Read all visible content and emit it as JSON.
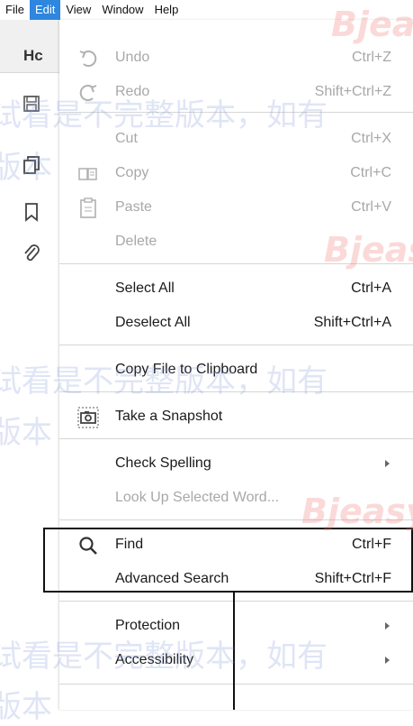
{
  "menubar": {
    "items": [
      {
        "label": "File",
        "active": false
      },
      {
        "label": "Edit",
        "active": true
      },
      {
        "label": "View",
        "active": false
      },
      {
        "label": "Window",
        "active": false
      },
      {
        "label": "Help",
        "active": false
      }
    ]
  },
  "app": {
    "tab_label": "Hc"
  },
  "menu": {
    "undo": {
      "label": "Undo",
      "shortcut": "Ctrl+Z"
    },
    "redo": {
      "label": "Redo",
      "shortcut": "Shift+Ctrl+Z"
    },
    "cut": {
      "label": "Cut",
      "shortcut": "Ctrl+X"
    },
    "copy": {
      "label": "Copy",
      "shortcut": "Ctrl+C"
    },
    "paste": {
      "label": "Paste",
      "shortcut": "Ctrl+V"
    },
    "delete": {
      "label": "Delete"
    },
    "select_all": {
      "label": "Select All",
      "shortcut": "Ctrl+A"
    },
    "deselect_all": {
      "label": "Deselect All",
      "shortcut": "Shift+Ctrl+A"
    },
    "copy_file": {
      "label": "Copy File to Clipboard"
    },
    "snapshot": {
      "label": "Take a Snapshot"
    },
    "spelling": {
      "label": "Check Spelling"
    },
    "lookup": {
      "label": "Look Up Selected Word..."
    },
    "find": {
      "label": "Find",
      "shortcut": "Ctrl+F"
    },
    "advanced_search": {
      "label": "Advanced Search",
      "shortcut": "Shift+Ctrl+F"
    },
    "protection": {
      "label": "Protection"
    },
    "accessibility": {
      "label": "Accessibility"
    }
  },
  "watermark": {
    "text1": "试看是不完整版本，如有",
    "text2": "版本",
    "logo": "Bjeasy"
  },
  "colors": {
    "menu_active": "#2e86de",
    "disabled_text": "#a8a8a8"
  }
}
